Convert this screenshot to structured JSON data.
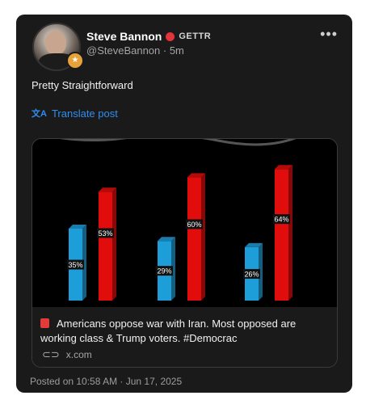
{
  "post": {
    "author": "Steve Bannon",
    "platform": "GETTR",
    "handle_time": "@SteveBannon · 5m",
    "text": "Pretty Straightforward",
    "translate_label": "Translate post",
    "timestamp": "Posted on 10:58 AM · Jun 17, 2025"
  },
  "link_preview": {
    "description": "Americans oppose war with Iran. Most opposed are working class & Trump voters. #Democrac",
    "domain": "x.com"
  },
  "chart_data": {
    "type": "bar",
    "series": [
      {
        "color": "#1e9ed8",
        "values": [
          35,
          29,
          26
        ]
      },
      {
        "color": "#e10d0d",
        "values": [
          53,
          60,
          64
        ]
      }
    ],
    "value_labels": [
      [
        "35%",
        "29%",
        "26%"
      ],
      [
        "53%",
        "60%",
        "64%"
      ]
    ],
    "ylim": [
      0,
      70
    ]
  },
  "icons": {
    "more": "more-horizontal-icon",
    "translate": "translate-icon",
    "link": "link-icon",
    "gettr": "gettr-logo-icon"
  }
}
